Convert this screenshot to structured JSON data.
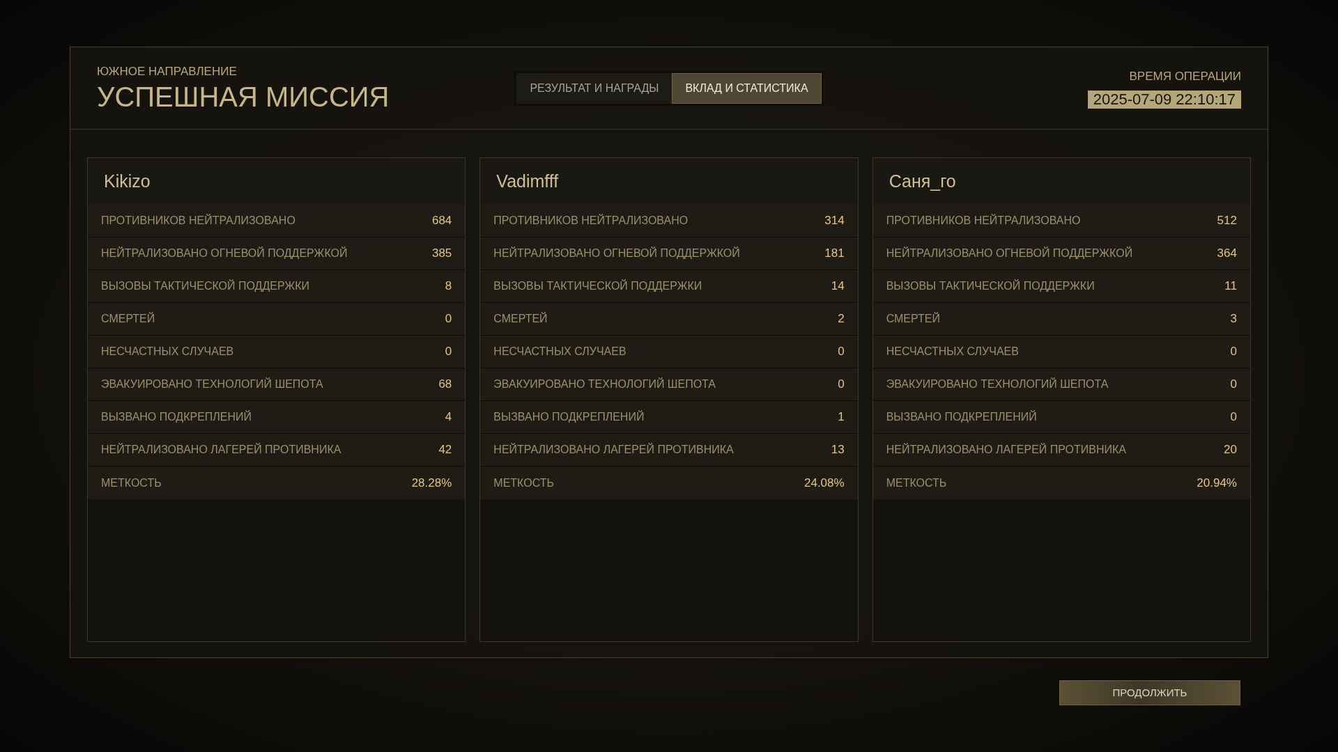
{
  "header": {
    "subtitle": "ЮЖНОЕ НАПРАВЛЕНИЕ",
    "title": "УСПЕШНАЯ МИССИЯ",
    "time_label": "ВРЕМЯ ОПЕРАЦИИ",
    "time_value": "2025-07-09 22:10:17"
  },
  "tabs": [
    {
      "label": "РЕЗУЛЬТАТ И НАГРАДЫ",
      "selected": false
    },
    {
      "label": "ВКЛАД И СТАТИСТИКА",
      "selected": true
    }
  ],
  "players": [
    {
      "name": "Kikizo",
      "stats": [
        {
          "label": "ПРОТИВНИКОВ НЕЙТРАЛИЗОВАНО",
          "value": "684"
        },
        {
          "label": "НЕЙТРАЛИЗОВАНО ОГНЕВОЙ ПОДДЕРЖКОЙ",
          "value": "385"
        },
        {
          "label": "ВЫЗОВЫ ТАКТИЧЕСКОЙ ПОДДЕРЖКИ",
          "value": "8"
        },
        {
          "label": "СМЕРТЕЙ",
          "value": "0"
        },
        {
          "label": "НЕСЧАСТНЫХ СЛУЧАЕВ",
          "value": "0"
        },
        {
          "label": "ЭВАКУИРОВАНО ТЕХНОЛОГИЙ ШЕПОТА",
          "value": "68"
        },
        {
          "label": "ВЫЗВАНО ПОДКРЕПЛЕНИЙ",
          "value": "4"
        },
        {
          "label": "НЕЙТРАЛИЗОВАНО ЛАГЕРЕЙ ПРОТИВНИКА",
          "value": "42"
        },
        {
          "label": "МЕТКОСТЬ",
          "value": "28.28%"
        }
      ]
    },
    {
      "name": "Vadimfff",
      "stats": [
        {
          "label": "ПРОТИВНИКОВ НЕЙТРАЛИЗОВАНО",
          "value": "314"
        },
        {
          "label": "НЕЙТРАЛИЗОВАНО ОГНЕВОЙ ПОДДЕРЖКОЙ",
          "value": "181"
        },
        {
          "label": "ВЫЗОВЫ ТАКТИЧЕСКОЙ ПОДДЕРЖКИ",
          "value": "14"
        },
        {
          "label": "СМЕРТЕЙ",
          "value": "2"
        },
        {
          "label": "НЕСЧАСТНЫХ СЛУЧАЕВ",
          "value": "0"
        },
        {
          "label": "ЭВАКУИРОВАНО ТЕХНОЛОГИЙ ШЕПОТА",
          "value": "0"
        },
        {
          "label": "ВЫЗВАНО ПОДКРЕПЛЕНИЙ",
          "value": "1"
        },
        {
          "label": "НЕЙТРАЛИЗОВАНО ЛАГЕРЕЙ ПРОТИВНИКА",
          "value": "13"
        },
        {
          "label": "МЕТКОСТЬ",
          "value": "24.08%"
        }
      ]
    },
    {
      "name": "Саня_го",
      "stats": [
        {
          "label": "ПРОТИВНИКОВ НЕЙТРАЛИЗОВАНО",
          "value": "512"
        },
        {
          "label": "НЕЙТРАЛИЗОВАНО ОГНЕВОЙ ПОДДЕРЖКОЙ",
          "value": "364"
        },
        {
          "label": "ВЫЗОВЫ ТАКТИЧЕСКОЙ ПОДДЕРЖКИ",
          "value": "11"
        },
        {
          "label": "СМЕРТЕЙ",
          "value": "3"
        },
        {
          "label": "НЕСЧАСТНЫХ СЛУЧАЕВ",
          "value": "0"
        },
        {
          "label": "ЭВАКУИРОВАНО ТЕХНОЛОГИЙ ШЕПОТА",
          "value": "0"
        },
        {
          "label": "ВЫЗВАНО ПОДКРЕПЛЕНИЙ",
          "value": "0"
        },
        {
          "label": "НЕЙТРАЛИЗОВАНО ЛАГЕРЕЙ ПРОТИВНИКА",
          "value": "20"
        },
        {
          "label": "МЕТКОСТЬ",
          "value": "20.94%"
        }
      ]
    }
  ],
  "continue_button": "ПРОДОЛЖИТЬ"
}
